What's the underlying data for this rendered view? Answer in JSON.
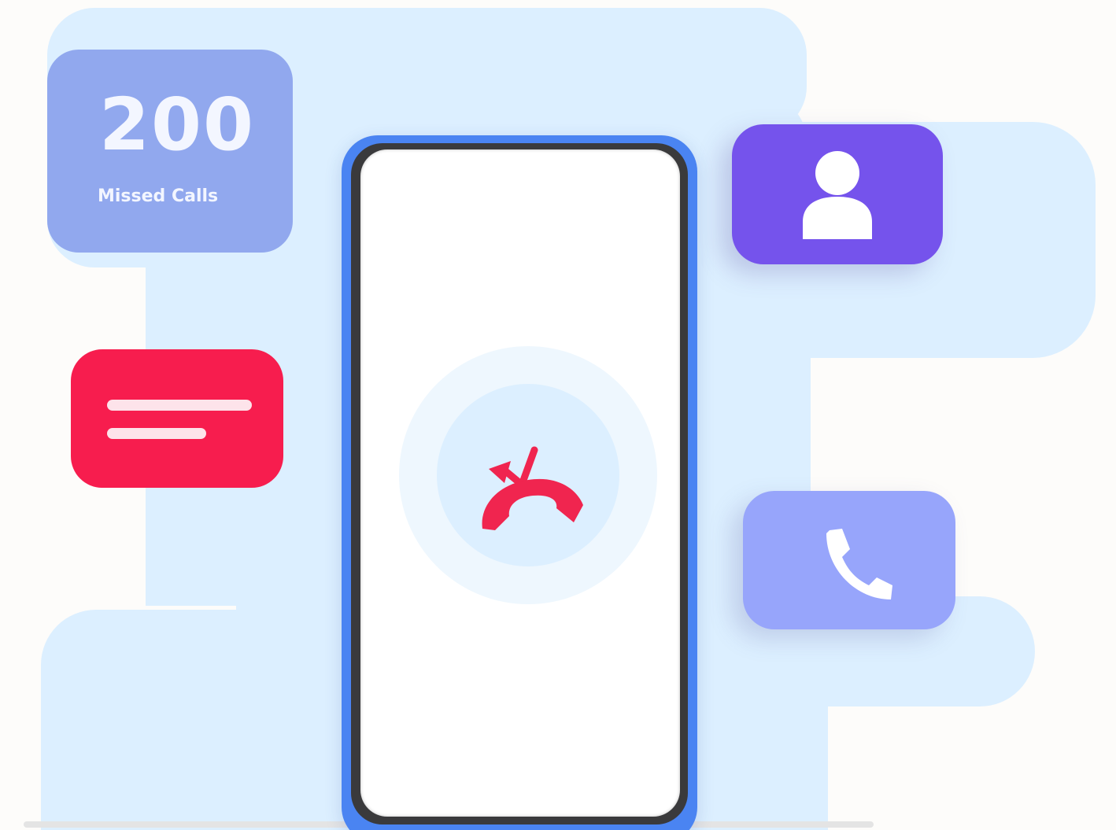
{
  "missed_calls_card": {
    "count": "200",
    "label": "Missed Calls"
  },
  "icons": {
    "missed_call": "missed-call-icon",
    "message": "message-lines-icon",
    "contact": "person-icon",
    "call": "phone-handset-icon"
  },
  "colors": {
    "background_blob": "#dcefff",
    "phone_frame": "#4a84f2",
    "missed_calls_card": "#91a8ee",
    "message_card": "#f71d4e",
    "contact_card": "#7553ec",
    "call_card": "#97a5fb",
    "missed_call_icon": "#f0254f"
  }
}
